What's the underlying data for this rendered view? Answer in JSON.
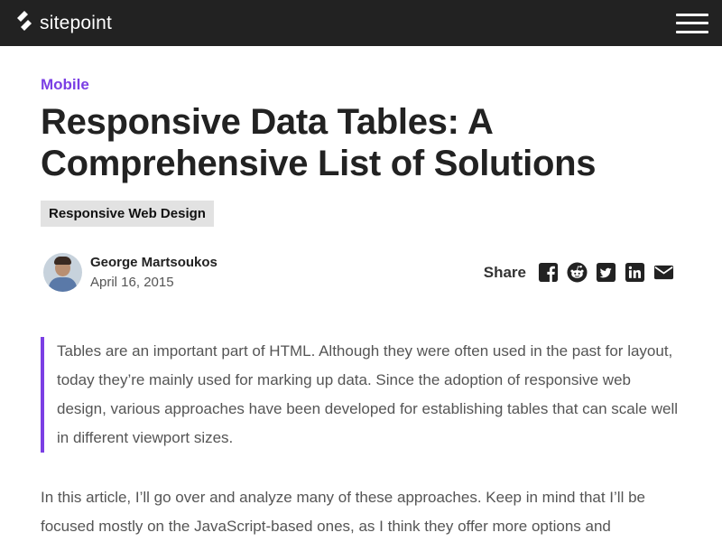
{
  "header": {
    "logo_text": "sitepoint",
    "menu_icon": "hamburger-menu-icon",
    "background": "#222222"
  },
  "article": {
    "category": "Mobile",
    "category_color": "#7b3fe4",
    "title_line1": "Responsive Data Tables: A",
    "title_line2": "Comprehensive List of Solutions",
    "tag": "Responsive Web Design",
    "author": {
      "name": "George Martsoukos",
      "date": "April 16, 2015"
    },
    "share": {
      "label": "Share",
      "icons": [
        "facebook-icon",
        "reddit-icon",
        "twitter-icon",
        "linkedin-icon",
        "email-icon"
      ]
    },
    "intro": "Tables are an important part of HTML. Although they were often used in the past for layout, today they’re mainly used for marking up data. Since the adoption of responsive web design, various approaches have been developed for establishing tables that can scale well in different viewport sizes.",
    "paragraph1": "In this article, I’ll go over and analyze many of these approaches. Keep in mind that I’ll be focused mostly on the JavaScript-based ones, as I think they offer more options and"
  }
}
